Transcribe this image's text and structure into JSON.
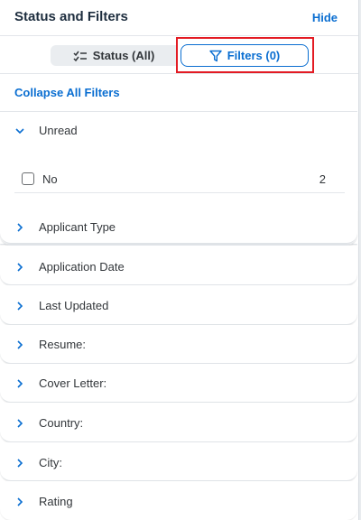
{
  "header": {
    "title": "Status and Filters",
    "hide_label": "Hide"
  },
  "segmented": {
    "status_label": "Status (All)",
    "status_icon": "list-check-icon",
    "filters_label": "Filters (0)",
    "filters_icon": "funnel-icon",
    "selected": "filters"
  },
  "collapse_all_label": "Collapse All Filters",
  "filters": [
    {
      "label": "Unread",
      "expanded": true
    },
    {
      "label": "Applicant Type",
      "expanded": false
    },
    {
      "label": "Application Date",
      "expanded": false
    },
    {
      "label": "Last Updated",
      "expanded": false
    },
    {
      "label": "Resume:",
      "expanded": false
    },
    {
      "label": "Cover Letter:",
      "expanded": false
    },
    {
      "label": "Country:",
      "expanded": false
    },
    {
      "label": "City:",
      "expanded": false
    },
    {
      "label": "Rating",
      "expanded": false
    }
  ],
  "unread_options": [
    {
      "label": "No",
      "count": "2",
      "checked": false
    }
  ],
  "colors": {
    "accent": "#0a6ed1",
    "highlight": "#e31b23",
    "text": "#32363a"
  }
}
